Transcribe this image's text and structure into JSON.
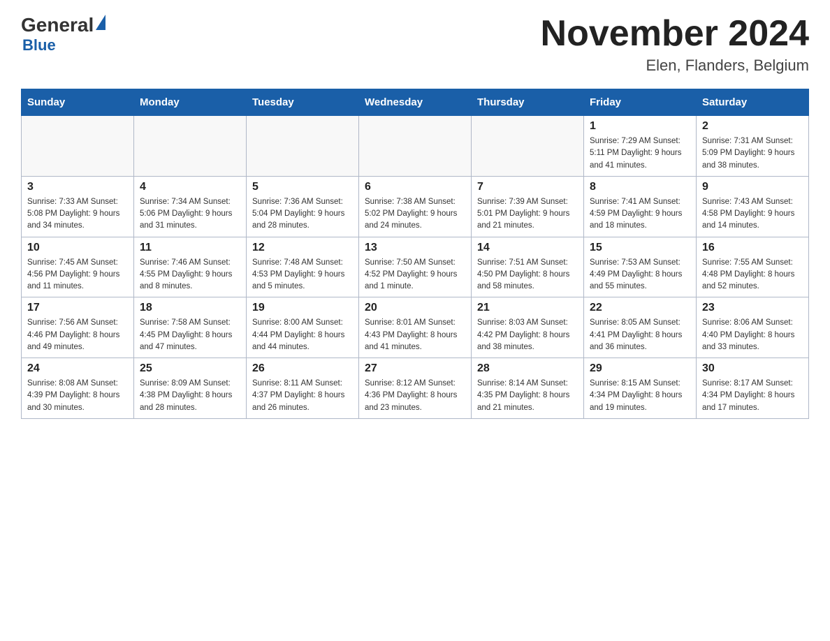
{
  "header": {
    "logo_general": "General",
    "logo_blue": "Blue",
    "title": "November 2024",
    "subtitle": "Elen, Flanders, Belgium"
  },
  "days_of_week": [
    "Sunday",
    "Monday",
    "Tuesday",
    "Wednesday",
    "Thursday",
    "Friday",
    "Saturday"
  ],
  "weeks": [
    [
      {
        "day": "",
        "info": ""
      },
      {
        "day": "",
        "info": ""
      },
      {
        "day": "",
        "info": ""
      },
      {
        "day": "",
        "info": ""
      },
      {
        "day": "",
        "info": ""
      },
      {
        "day": "1",
        "info": "Sunrise: 7:29 AM\nSunset: 5:11 PM\nDaylight: 9 hours\nand 41 minutes."
      },
      {
        "day": "2",
        "info": "Sunrise: 7:31 AM\nSunset: 5:09 PM\nDaylight: 9 hours\nand 38 minutes."
      }
    ],
    [
      {
        "day": "3",
        "info": "Sunrise: 7:33 AM\nSunset: 5:08 PM\nDaylight: 9 hours\nand 34 minutes."
      },
      {
        "day": "4",
        "info": "Sunrise: 7:34 AM\nSunset: 5:06 PM\nDaylight: 9 hours\nand 31 minutes."
      },
      {
        "day": "5",
        "info": "Sunrise: 7:36 AM\nSunset: 5:04 PM\nDaylight: 9 hours\nand 28 minutes."
      },
      {
        "day": "6",
        "info": "Sunrise: 7:38 AM\nSunset: 5:02 PM\nDaylight: 9 hours\nand 24 minutes."
      },
      {
        "day": "7",
        "info": "Sunrise: 7:39 AM\nSunset: 5:01 PM\nDaylight: 9 hours\nand 21 minutes."
      },
      {
        "day": "8",
        "info": "Sunrise: 7:41 AM\nSunset: 4:59 PM\nDaylight: 9 hours\nand 18 minutes."
      },
      {
        "day": "9",
        "info": "Sunrise: 7:43 AM\nSunset: 4:58 PM\nDaylight: 9 hours\nand 14 minutes."
      }
    ],
    [
      {
        "day": "10",
        "info": "Sunrise: 7:45 AM\nSunset: 4:56 PM\nDaylight: 9 hours\nand 11 minutes."
      },
      {
        "day": "11",
        "info": "Sunrise: 7:46 AM\nSunset: 4:55 PM\nDaylight: 9 hours\nand 8 minutes."
      },
      {
        "day": "12",
        "info": "Sunrise: 7:48 AM\nSunset: 4:53 PM\nDaylight: 9 hours\nand 5 minutes."
      },
      {
        "day": "13",
        "info": "Sunrise: 7:50 AM\nSunset: 4:52 PM\nDaylight: 9 hours\nand 1 minute."
      },
      {
        "day": "14",
        "info": "Sunrise: 7:51 AM\nSunset: 4:50 PM\nDaylight: 8 hours\nand 58 minutes."
      },
      {
        "day": "15",
        "info": "Sunrise: 7:53 AM\nSunset: 4:49 PM\nDaylight: 8 hours\nand 55 minutes."
      },
      {
        "day": "16",
        "info": "Sunrise: 7:55 AM\nSunset: 4:48 PM\nDaylight: 8 hours\nand 52 minutes."
      }
    ],
    [
      {
        "day": "17",
        "info": "Sunrise: 7:56 AM\nSunset: 4:46 PM\nDaylight: 8 hours\nand 49 minutes."
      },
      {
        "day": "18",
        "info": "Sunrise: 7:58 AM\nSunset: 4:45 PM\nDaylight: 8 hours\nand 47 minutes."
      },
      {
        "day": "19",
        "info": "Sunrise: 8:00 AM\nSunset: 4:44 PM\nDaylight: 8 hours\nand 44 minutes."
      },
      {
        "day": "20",
        "info": "Sunrise: 8:01 AM\nSunset: 4:43 PM\nDaylight: 8 hours\nand 41 minutes."
      },
      {
        "day": "21",
        "info": "Sunrise: 8:03 AM\nSunset: 4:42 PM\nDaylight: 8 hours\nand 38 minutes."
      },
      {
        "day": "22",
        "info": "Sunrise: 8:05 AM\nSunset: 4:41 PM\nDaylight: 8 hours\nand 36 minutes."
      },
      {
        "day": "23",
        "info": "Sunrise: 8:06 AM\nSunset: 4:40 PM\nDaylight: 8 hours\nand 33 minutes."
      }
    ],
    [
      {
        "day": "24",
        "info": "Sunrise: 8:08 AM\nSunset: 4:39 PM\nDaylight: 8 hours\nand 30 minutes."
      },
      {
        "day": "25",
        "info": "Sunrise: 8:09 AM\nSunset: 4:38 PM\nDaylight: 8 hours\nand 28 minutes."
      },
      {
        "day": "26",
        "info": "Sunrise: 8:11 AM\nSunset: 4:37 PM\nDaylight: 8 hours\nand 26 minutes."
      },
      {
        "day": "27",
        "info": "Sunrise: 8:12 AM\nSunset: 4:36 PM\nDaylight: 8 hours\nand 23 minutes."
      },
      {
        "day": "28",
        "info": "Sunrise: 8:14 AM\nSunset: 4:35 PM\nDaylight: 8 hours\nand 21 minutes."
      },
      {
        "day": "29",
        "info": "Sunrise: 8:15 AM\nSunset: 4:34 PM\nDaylight: 8 hours\nand 19 minutes."
      },
      {
        "day": "30",
        "info": "Sunrise: 8:17 AM\nSunset: 4:34 PM\nDaylight: 8 hours\nand 17 minutes."
      }
    ]
  ]
}
